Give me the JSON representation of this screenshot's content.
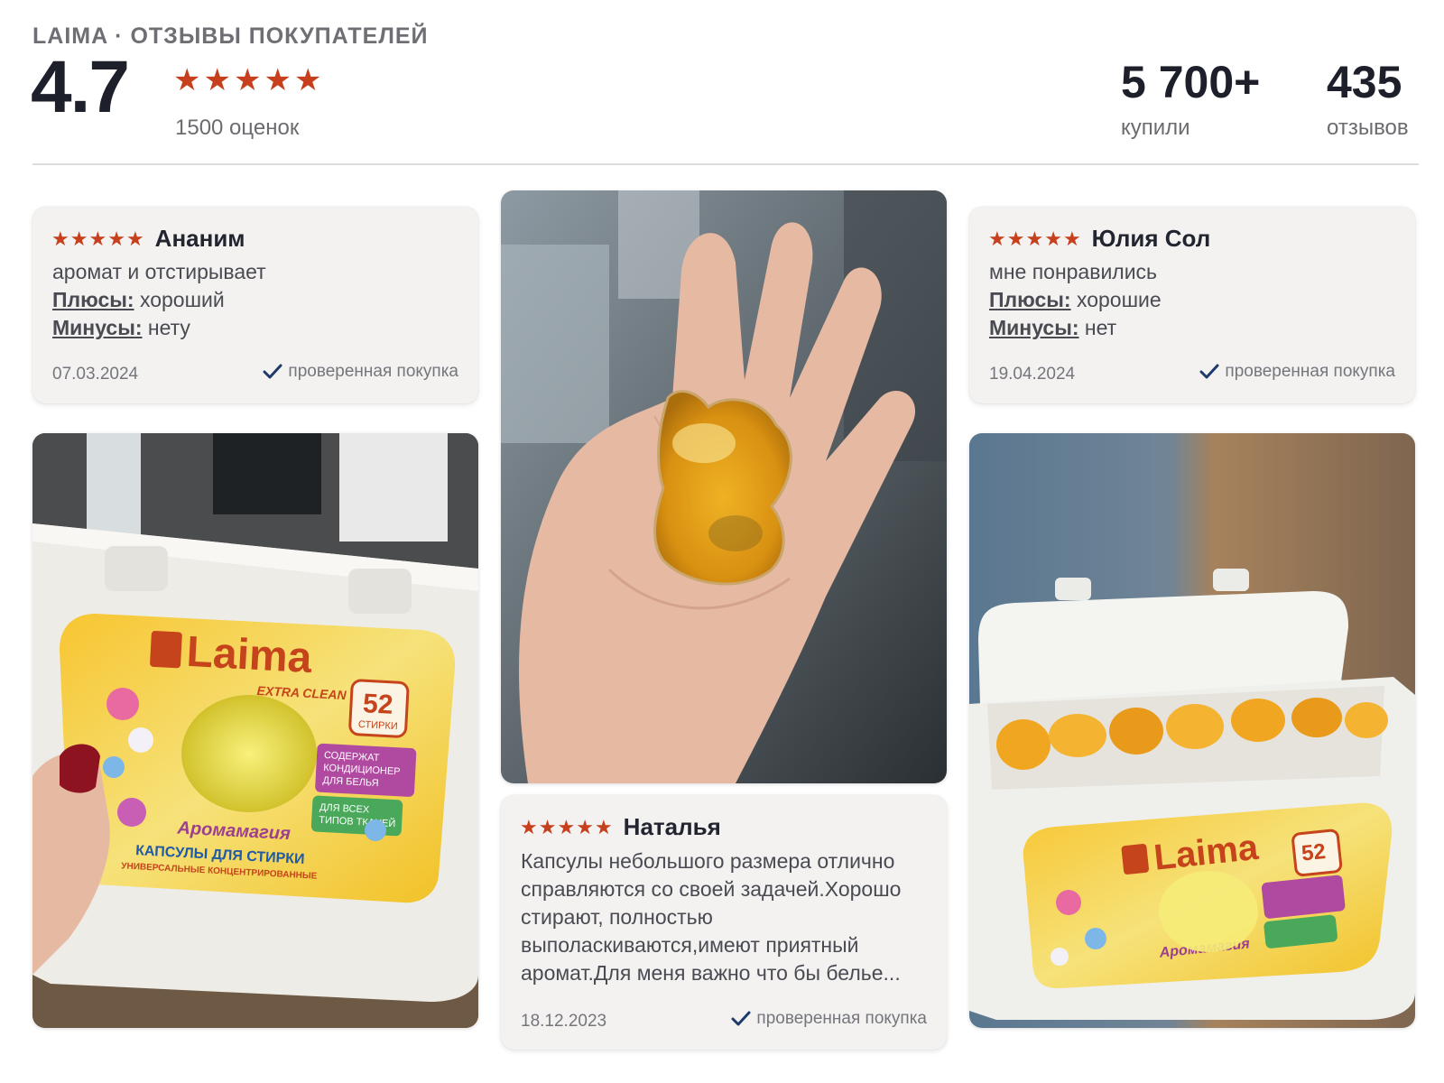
{
  "header": {
    "brand_line": "LAIMA · ОТЗЫВЫ ПОКУПАТЕЛЕЙ",
    "rating": "4.7",
    "stars": 5,
    "ratings_count": "1500 оценок",
    "stats": [
      {
        "value": "5 700+",
        "caption": "купили"
      },
      {
        "value": "435",
        "caption": "отзывов"
      }
    ]
  },
  "colors": {
    "star": "#c7401d",
    "card_bg": "#f3f2f1",
    "check": "#1d3a6b"
  },
  "reviews": [
    {
      "stars": 5,
      "author": "Ананим",
      "text": "аромат и отстирывает",
      "pros_label": "Плюсы:",
      "pros": "хороший",
      "cons_label": "Минусы:",
      "cons": "нету",
      "date": "07.03.2024",
      "verified": "проверенная покупка"
    },
    {
      "stars": 5,
      "author": "Юлия Сол",
      "text": "мне понравились",
      "pros_label": "Плюсы:",
      "pros": "хорошие",
      "cons_label": "Минусы:",
      "cons": "нет",
      "date": "19.04.2024",
      "verified": "проверенная покупка"
    },
    {
      "stars": 5,
      "author": "Наталья",
      "text": "Капсулы небольшого размера отлично справляются со своей задачей.Хорошо стирают, полностью выполаскиваются,имеют приятный аромат.Для меня важно что бы белье...",
      "date": "18.12.2023",
      "verified": "проверенная покупка"
    }
  ],
  "product_label": {
    "brand": "Laima",
    "sub": "EXTRA CLEAN",
    "count": "52",
    "count_unit": "СТИРКИ",
    "badge1": [
      "СОДЕРЖАТ",
      "КОНДИЦИОНЕР",
      "ДЛЯ БЕЛЬЯ"
    ],
    "badge2": [
      "ДЛЯ ВСЕХ",
      "ТИПОВ ТКАНЕЙ"
    ],
    "title": "Аромамагия",
    "caption": "КАПСУЛЫ ДЛЯ СТИРКИ",
    "caption2": "УНИВЕРСАЛЬНЫЕ КОНЦЕНТРИРОВАННЫЕ"
  },
  "icons": [
    "star-icon",
    "checkmark-icon"
  ]
}
